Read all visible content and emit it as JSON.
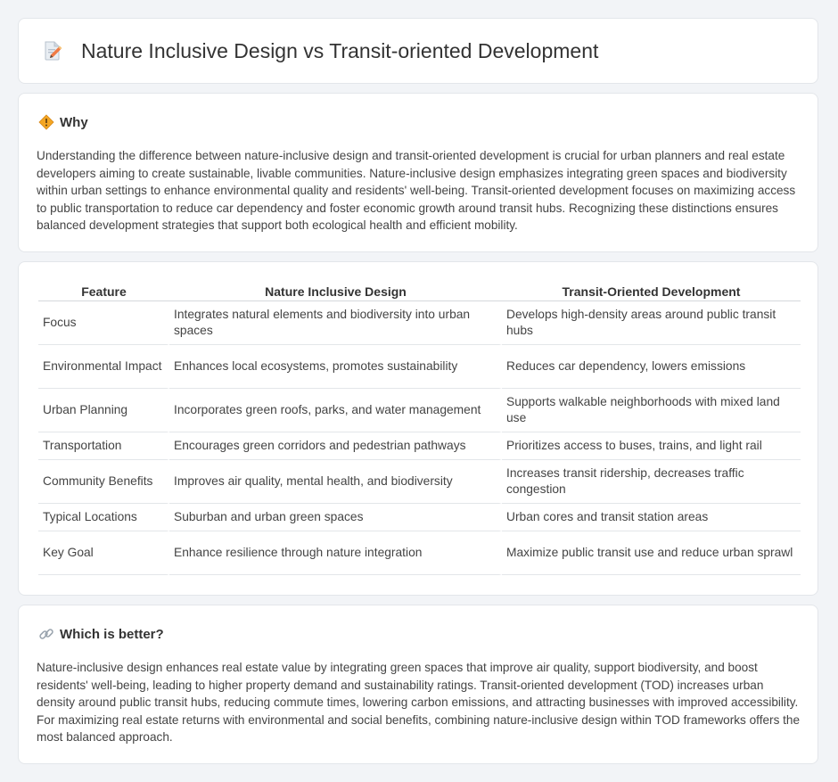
{
  "title": "Nature Inclusive Design vs Transit-oriented Development",
  "why": {
    "heading": "Why",
    "text": "Understanding the difference between nature-inclusive design and transit-oriented development is crucial for urban planners and real estate developers aiming to create sustainable, livable communities. Nature-inclusive design emphasizes integrating green spaces and biodiversity within urban settings to enhance environmental quality and residents' well-being. Transit-oriented development focuses on maximizing access to public transportation to reduce car dependency and foster economic growth around transit hubs. Recognizing these distinctions ensures balanced development strategies that support both ecological health and efficient mobility."
  },
  "table": {
    "headers": [
      "Feature",
      "Nature Inclusive Design",
      "Transit-Oriented Development"
    ],
    "rows": [
      [
        "Focus",
        "Integrates natural elements and biodiversity into urban spaces",
        "Develops high-density areas around public transit hubs"
      ],
      [
        "Environmental Impact",
        "Enhances local ecosystems, promotes sustainability",
        "Reduces car dependency, lowers emissions"
      ],
      [
        "Urban Planning",
        "Incorporates green roofs, parks, and water management",
        "Supports walkable neighborhoods with mixed land use"
      ],
      [
        "Transportation",
        "Encourages green corridors and pedestrian pathways",
        "Prioritizes access to buses, trains, and light rail"
      ],
      [
        "Community Benefits",
        "Improves air quality, mental health, and biodiversity",
        "Increases transit ridership, decreases traffic congestion"
      ],
      [
        "Typical Locations",
        "Suburban and urban green spaces",
        "Urban cores and transit station areas"
      ],
      [
        "Key Goal",
        "Enhance resilience through nature integration",
        "Maximize public transit use and reduce urban sprawl"
      ]
    ]
  },
  "better": {
    "heading": "Which is better?",
    "text": "Nature-inclusive design enhances real estate value by integrating green spaces that improve air quality, support biodiversity, and boost residents' well-being, leading to higher property demand and sustainability ratings. Transit-oriented development (TOD) increases urban density around public transit hubs, reducing commute times, lowering carbon emissions, and attracting businesses with improved accessibility. For maximizing real estate returns with environmental and social benefits, combining nature-inclusive design within TOD frameworks offers the most balanced approach."
  },
  "icons": {
    "title": "document-pencil-icon",
    "why": "diamond-sign-icon",
    "better": "link-icon"
  },
  "colors": {
    "background": "#f2f4f7",
    "card": "#ffffff",
    "warning": "#f4a623"
  }
}
